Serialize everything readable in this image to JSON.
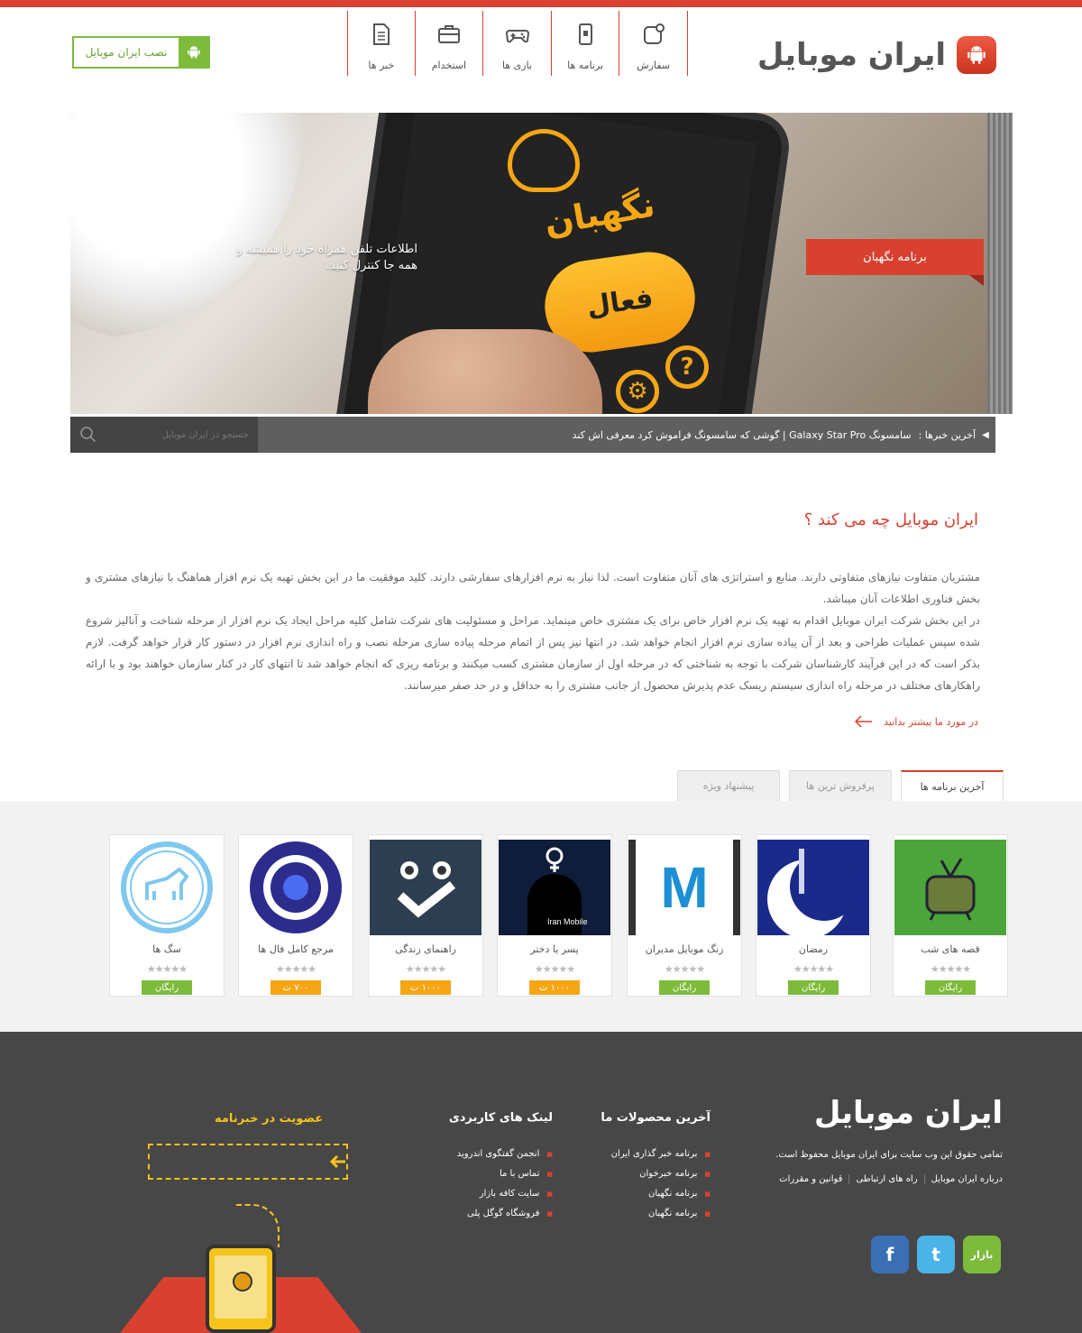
{
  "header": {
    "logo_text": "ایران موبایل",
    "install_button": "نصب ایران موبایل",
    "nav": [
      {
        "label": "سفارش",
        "icon": "order-icon"
      },
      {
        "label": "برنامه ها",
        "icon": "apps-icon"
      },
      {
        "label": "بازی ها",
        "icon": "gamepad-icon"
      },
      {
        "label": "استخدام",
        "icon": "briefcase-icon"
      },
      {
        "label": "خبر ها",
        "icon": "document-icon"
      }
    ]
  },
  "slider": {
    "caption": "اطلاعات تلفن همراه خود را همیشه و همه جا کنترل کنید.",
    "ribbon": "برنامه نگهبان",
    "app_title": "نگهبان",
    "button_text": "فعال"
  },
  "ticker": {
    "label": "آخرین خبرها :",
    "news": "سامسونگ Galaxy Star Pro | گوشی که سامسونگ فراموش کرد معرفی اش کند",
    "search_placeholder": "جستجو در ایران موبایل"
  },
  "about": {
    "title": "ایران موبایل چه می کند ؟",
    "paragraph1": "مشتریان متفاوت نیازهای متفاوتی دارند. منابع و استراتژی های آنان متفاوت است. لذا نیاز به نرم افزارهای سفارشی دارند. کلید موفقیت ما در این بخش تهیه یک نرم افزار هماهنگ با نیازهای مشتری و بخش فناوری اطلاعات آنان میباشد.",
    "paragraph2": "در این بخش شرکت ایران موبایل اقدام به تهیه یک نرم افزار خاص برای یک مشتری خاص مینماید. مراحل و مسئولیت های شرکت شامل کلیه مراحل ایجاد یک نرم افزار از مرحله شناخت و آنالیز شروع شده سپس عملیات طراحی و بعد از آن پیاده سازی نرم افزار انجام خواهد شد. در انتها نیز پس از اتمام مرحله پیاده سازی مرحله نصب و راه اندازی نرم افزار در دستور کار قرار خواهد گرفت. لازم بذکر است که در این فرآیند کارشناسان شرکت با توجه به شناختی که در مرحله اول از سازمان مشتری کسب میکنند و برنامه ریزی که انجام خواهد شد تا انتهای کار در کنار سازمان خواهند بود و با ارائه راهکارهای مختلف در مرحله راه اندازی سیستم ریسک عدم پذیرش محصول از جانب مشتری را به حداقل و در حد صفر میرسانند.",
    "more_link": "در مورد ما بیشتر بدانید"
  },
  "tabs": [
    "آخرین برنامه ها",
    "پرفروش ترین ها",
    "پیشنهاد ویژه"
  ],
  "apps": [
    {
      "name": "قصه های شب",
      "price": "رایگان",
      "type": "free"
    },
    {
      "name": "رمضان",
      "price": "رایگان",
      "type": "free"
    },
    {
      "name": "زنگ موبایل مدیران",
      "price": "رایگان",
      "type": "free",
      "thumb_letter": "M"
    },
    {
      "name": "پسر یا دختر",
      "price": "۱۰۰۰ ت",
      "type": "paid",
      "thumb_text": "Iran Mobile"
    },
    {
      "name": "راهنمای زندگی",
      "price": "۱۰۰۰ ت",
      "type": "paid"
    },
    {
      "name": "مرجع کامل فال ها",
      "price": "۷۰۰ ت",
      "type": "paid"
    },
    {
      "name": "سگ ها",
      "price": "رایگان",
      "type": "free"
    }
  ],
  "rating_stars": "★★★★★",
  "footer": {
    "logo_text": "ایران موبایل",
    "copyright": "تمامی حقوق این وب سایت برای ایران موبایل محفوظ است.",
    "links": [
      "درباره ایران موبایل",
      "راه های ارتباطی",
      "قوانین و مقررات"
    ],
    "products_title": "آخرین محصولات ما",
    "products": [
      "برنامه خبر گذاری ایران",
      "برنامه خبرخوان",
      "برنامه نگهبان",
      "برنامه نگهبان"
    ],
    "useful_title": "لینک های کاربردی",
    "useful": [
      "انجمن گفتگوی اندروید",
      "تماس با ما",
      "سایت کافه بازار",
      "فروشگاه گوگل پلی"
    ],
    "newsletter_title": "عضویت در خبرنامه",
    "social": [
      {
        "name": "bazaar",
        "label": "بازار",
        "color": "#7dbb3a"
      },
      {
        "name": "twitter",
        "label": "t",
        "color": "#4ab3e8"
      },
      {
        "name": "facebook",
        "label": "f",
        "color": "#3b6fb6"
      }
    ]
  },
  "colors": {
    "accent": "#d8412f",
    "green": "#7dbb3a",
    "orange": "#f5a615",
    "footer": "#474747"
  }
}
